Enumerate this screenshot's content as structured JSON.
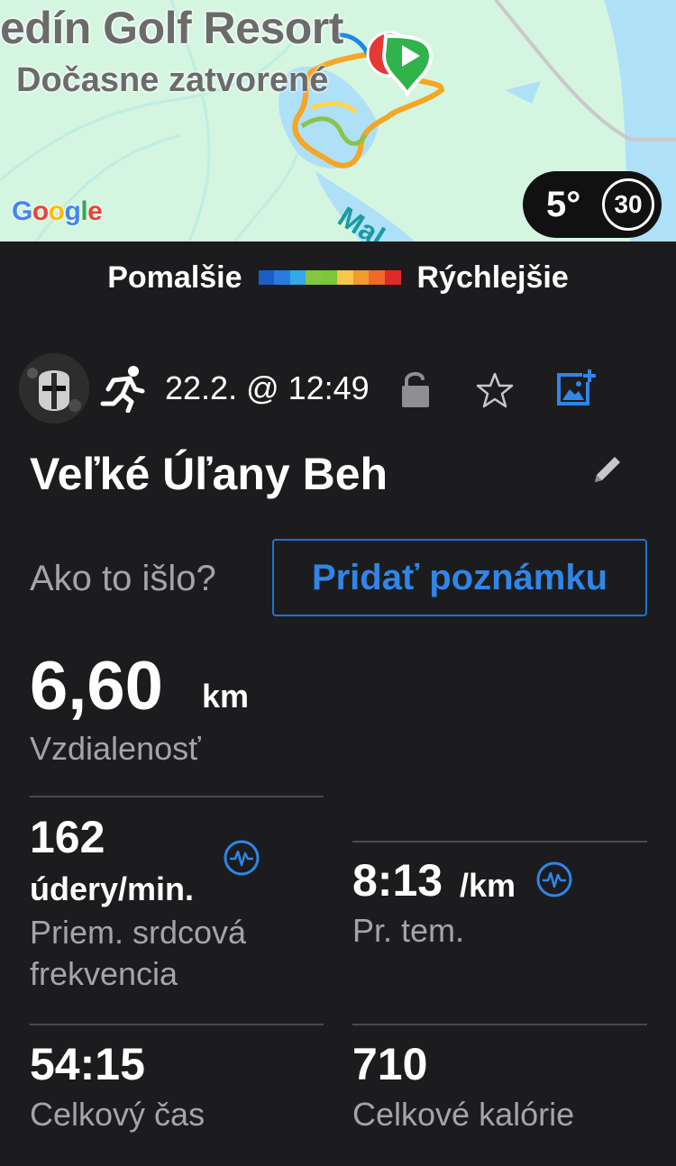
{
  "map": {
    "place_name": "edín Golf Resort",
    "place_status": "Dočasne zatvorené",
    "google_logo": [
      {
        "ch": "G",
        "color": "#4285F4"
      },
      {
        "ch": "o",
        "color": "#EA4335"
      },
      {
        "ch": "o",
        "color": "#FBBC05"
      },
      {
        "ch": "g",
        "color": "#4285F4"
      },
      {
        "ch": "l",
        "color": "#34A853"
      },
      {
        "ch": "e",
        "color": "#EA4335"
      }
    ],
    "road_label": "Mal",
    "weather_temp": "5°",
    "air_quality": "30"
  },
  "legend": {
    "slower_label": "Pomalšie",
    "faster_label": "Rýchlejšie",
    "colors": [
      "#1a5fc4",
      "#2a7be0",
      "#35a8e8",
      "#86c540",
      "#7cc63a",
      "#f7c64a",
      "#f19a32",
      "#ef6a2a",
      "#e02a2a"
    ]
  },
  "activity": {
    "type_icon": "running-person-icon",
    "datetime": "22.2. @ 12:49",
    "title": "Veľké Úľany Beh",
    "prompt_label": "Ako to išlo?",
    "add_note_label": "Pridať poznámku"
  },
  "stats": {
    "distance": {
      "value": "6,60",
      "unit": "km",
      "label": "Vzdialenosť"
    },
    "heart_rate": {
      "value": "162",
      "unit": "údery/min.",
      "label_line1": "Priem. srdcová",
      "label_line2": "frekvencia"
    },
    "pace": {
      "value": "8:13",
      "unit": "/km",
      "label": "Pr. tem."
    },
    "total_time": {
      "value": "54:15",
      "label": "Celkový čas"
    },
    "calories": {
      "value": "710",
      "label": "Celkové kalórie"
    }
  },
  "colors": {
    "accent": "#1e73d2",
    "background": "#1c1c1e",
    "secondary_text": "#a5a5a8"
  }
}
